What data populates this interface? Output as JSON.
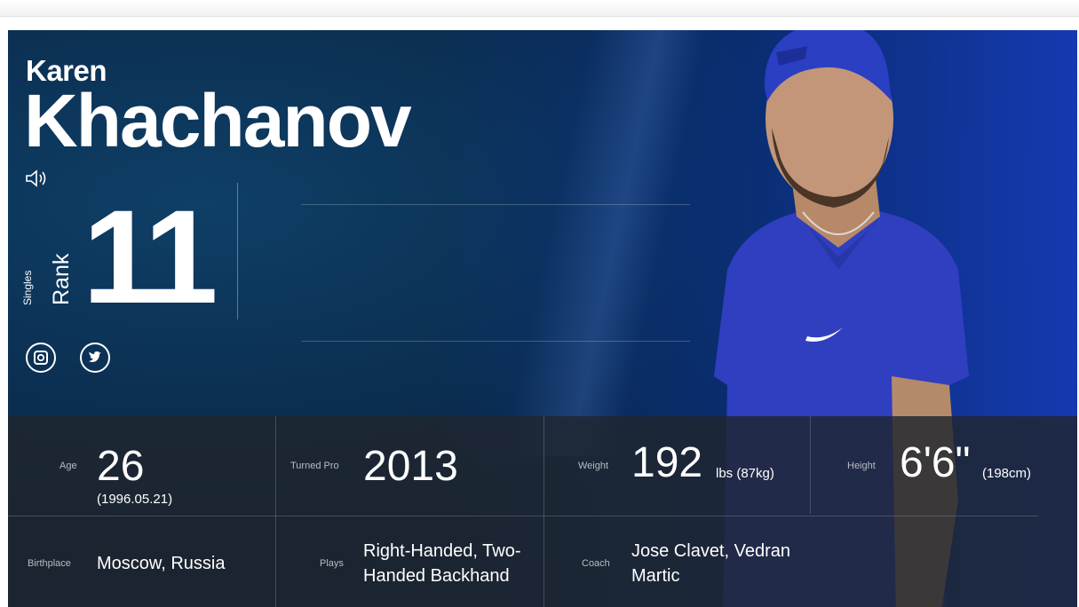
{
  "player": {
    "first_name": "Karen",
    "last_name": "Khachanov"
  },
  "rank": {
    "type_label": "Singles",
    "label": "Rank",
    "value": "11"
  },
  "icons": {
    "audio": "speaker-icon",
    "instagram": "instagram-icon",
    "twitter": "twitter-icon"
  },
  "stats": {
    "age": {
      "label": "Age",
      "value": "26",
      "sub": "(1996.05.21)"
    },
    "turned_pro": {
      "label": "Turned Pro",
      "value": "2013"
    },
    "weight": {
      "label": "Weight",
      "value": "192",
      "unit": "lbs (87kg)"
    },
    "height": {
      "label": "Height",
      "value": "6'6\"",
      "unit": "(198cm)"
    },
    "birthplace": {
      "label": "Birthplace",
      "value": "Moscow, Russia"
    },
    "plays": {
      "label": "Plays",
      "value_line1": "Right-Handed, Two-",
      "value_line2": "Handed Backhand"
    },
    "coach": {
      "label": "Coach",
      "value_line1": "Jose Clavet, Vedran",
      "value_line2": "Martic"
    }
  },
  "colors": {
    "background": "#0b2f52",
    "accent_blue": "#2b44c6",
    "stats_bg": "#20262e",
    "text": "#ffffff"
  }
}
